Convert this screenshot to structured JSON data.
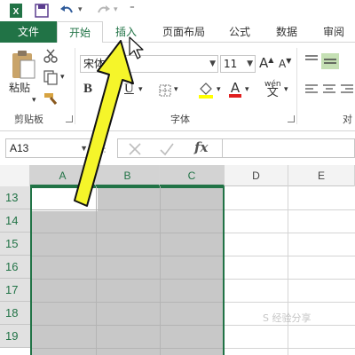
{
  "tabs": {
    "file": "文件",
    "home": "开始",
    "insert": "插入",
    "page_layout": "页面布局",
    "formulas": "公式",
    "data": "数据",
    "review": "审阅"
  },
  "ribbon": {
    "clipboard": {
      "paste_label": "粘贴",
      "group_label": "剪贴板"
    },
    "font": {
      "font_name": "宋体",
      "font_size": "11",
      "bold": "B",
      "underline": "U",
      "grow": "A",
      "shrink": "A",
      "font_color_letter": "A",
      "wen": "wén",
      "wen_char": "文",
      "group_label": "字体"
    },
    "alignment": {
      "group_label_partial": "对"
    }
  },
  "formula_bar": {
    "name_box": "A13",
    "fx": "fx",
    "formula": ""
  },
  "sheet": {
    "columns": [
      "A",
      "B",
      "C",
      "D",
      "E"
    ],
    "rows": [
      "13",
      "14",
      "15",
      "16",
      "17",
      "18",
      "19"
    ],
    "selected_columns": [
      "A",
      "B",
      "C"
    ],
    "active_cell": "A13"
  },
  "colors": {
    "excel_green": "#217346",
    "selection_fill": "#c8c8c8",
    "arrow_yellow": "#f5f52a"
  },
  "watermark": "S 经验分享"
}
